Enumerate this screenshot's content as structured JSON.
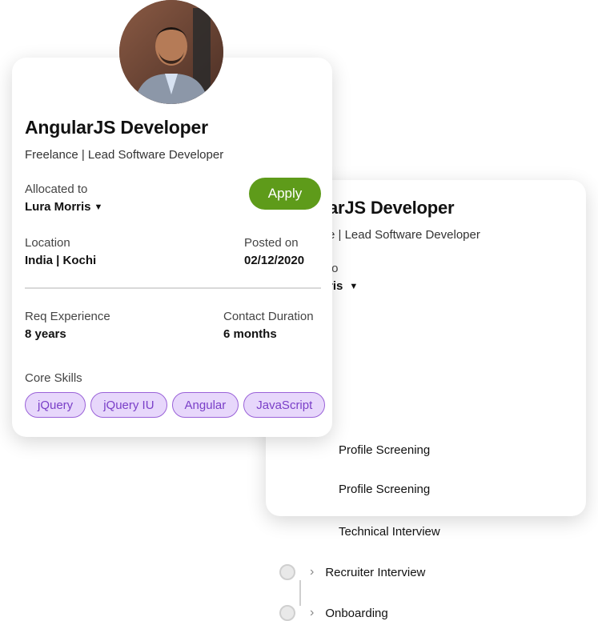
{
  "back_card": {
    "title": "arJS Developer",
    "subtitle": "e | Lead Software Developer",
    "allocated_label": "to",
    "allocated_name": "ris",
    "steps": [
      {
        "label": "Profile Screening",
        "visible_prefix_cut": true
      },
      {
        "label": "Profile Screening",
        "visible_prefix_cut": true
      },
      {
        "label": "Technical Interview",
        "visible_prefix_cut": true
      },
      {
        "label": "Recruiter Interview",
        "visible_prefix_cut": false
      },
      {
        "label": "Onboarding",
        "visible_prefix_cut": false
      }
    ]
  },
  "front_card": {
    "title": "AngularJS Developer",
    "subtitle": "Freelance | Lead Software Developer",
    "allocated_label": "Allocated to",
    "allocated_name": "Lura Morris",
    "apply_label": "Apply",
    "location_label": "Location",
    "location_value": "India | Kochi",
    "posted_label": "Posted on",
    "posted_value": "02/12/2020",
    "experience_label": "Req Experience",
    "experience_value": "8 years",
    "duration_label": "Contact Duration",
    "duration_value": "6 months",
    "skills_label": "Core Skills",
    "skills": [
      "jQuery",
      "jQuery IU",
      "Angular",
      "JavaScript"
    ]
  },
  "colors": {
    "apply_bg": "#5e9b1a",
    "skill_bg": "#e7d7fb",
    "skill_border": "#9a62d8",
    "skill_text": "#7a3fc8"
  },
  "icons": {
    "dropdown": "caret-down-icon",
    "step_chevron": "chevron-right-icon",
    "step_marker": "step-circle-icon"
  }
}
